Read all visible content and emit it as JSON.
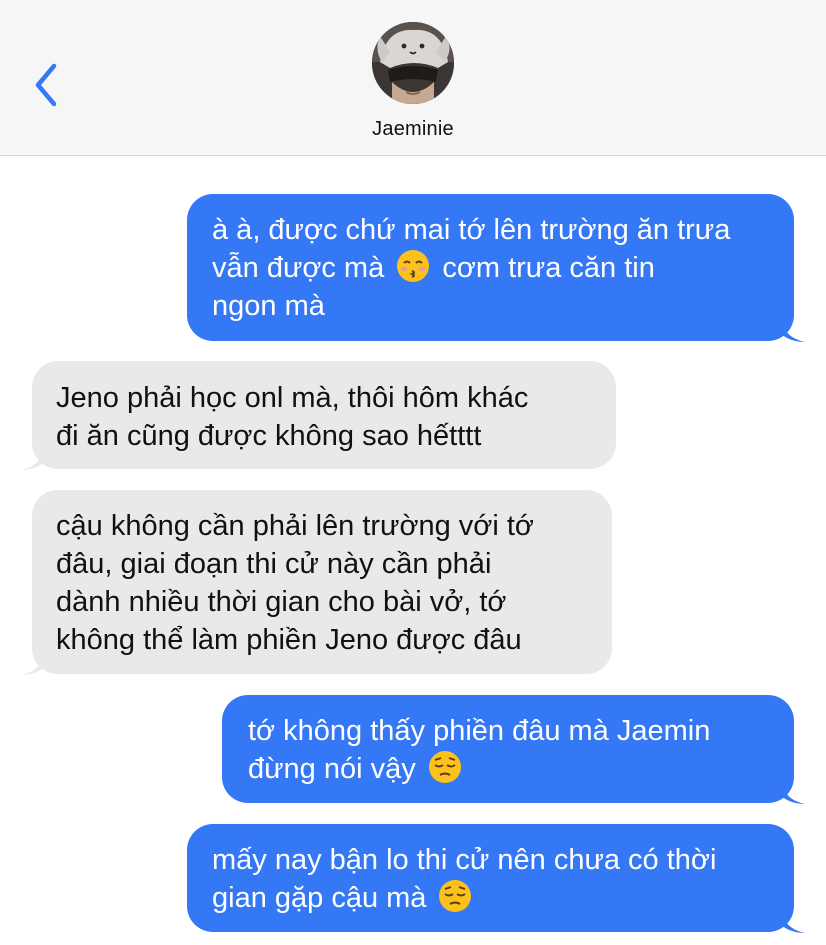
{
  "header": {
    "contact_name": "Jaeminie",
    "back_icon": "chevron-left-icon",
    "accent_color": "#3478f6"
  },
  "messages": [
    {
      "direction": "outgoing",
      "text_before": "à à, được chứ mai tớ lên trường ăn trưa\nvẫn được mà ",
      "emoji": "kissing-closed-eyes-emoji",
      "text_after": " cơm trưa căn tin\nngon mà"
    },
    {
      "direction": "incoming",
      "text": "Jeno phải học onl mà, thôi hôm khác\nđi ăn cũng được không sao hếtttt"
    },
    {
      "direction": "incoming",
      "text": "cậu không cần phải lên trường với tớ\nđâu, giai đoạn thi cử này cần phải\ndành nhiều thời gian cho bài vở, tớ\nkhông thể làm phiền Jeno được đâu"
    },
    {
      "direction": "outgoing",
      "text_before": "tớ không thấy phiền đâu mà Jaemin\nđừng nói vậy ",
      "emoji": "pensive-face-emoji",
      "text_after": ""
    },
    {
      "direction": "outgoing",
      "text_before": "mấy nay bận lo thi cử nên chưa có thời\ngian gặp cậu mà ",
      "emoji": "pensive-face-emoji",
      "text_after": ""
    }
  ],
  "colors": {
    "outgoing_bubble": "#3478f6",
    "incoming_bubble": "#e9e9eb",
    "header_bg": "#f6f6f6"
  }
}
